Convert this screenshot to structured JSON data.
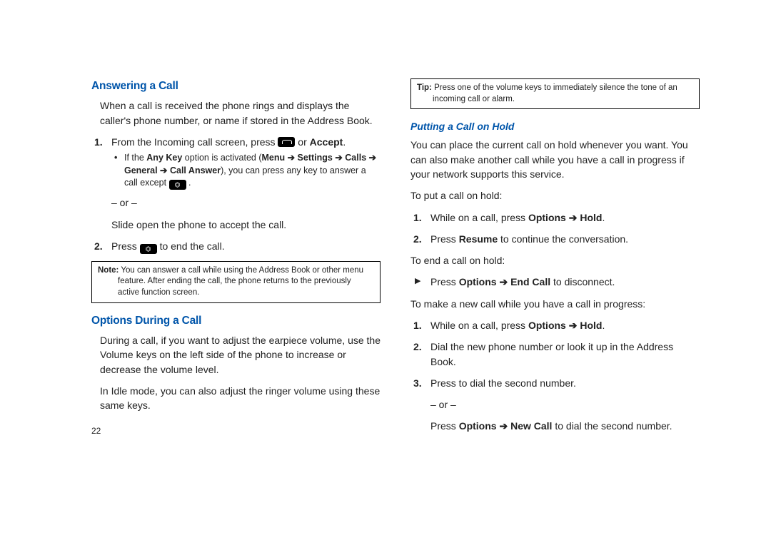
{
  "left": {
    "h_answering": "Answering a Call",
    "p_answer_intro": "When a call is received the phone rings and displays the caller's phone number, or name if stored in the Address Book.",
    "step1_pre": "From the Incoming call screen, press ",
    "step1_post": " or ",
    "accept": "Accept",
    "bullet_anykey_1": "If the ",
    "anykey": "Any Key",
    "bullet_anykey_2": " option is activated (",
    "menu": "Menu",
    "settings": "Settings",
    "calls": "Calls",
    "general": "General",
    "callanswer": "Call Answer",
    "bullet_anykey_3": "), you can press any key to answer a call except ",
    "or": "– or –",
    "slide": "Slide open the phone to accept the call.",
    "step2_pre": "Press ",
    "step2_post": " to end the call.",
    "note_lead": "Note:",
    "note_body": " You can answer a call while using the Address Book or other menu feature. After ending the call, the phone returns to the previously active function screen.",
    "h_options": "Options During a Call",
    "p_volume": "During a call, if you want to adjust the earpiece volume, use the Volume keys on the left side of the phone to increase or decrease the volume level.",
    "p_idle": "In Idle mode, you can also adjust the ringer volume using these same keys.",
    "pagenum": "22"
  },
  "right": {
    "tip_lead": "Tip:",
    "tip_body": " Press one of the volume keys to immediately silence the tone of an incoming call or alarm.",
    "h_hold": "Putting a Call on Hold",
    "p_hold_intro": "You can place the current call on hold whenever you want. You can also make another call while you have a call in progress if your network supports this service.",
    "p_toput": "To put a call on hold:",
    "s1_pre": "While on a call, press ",
    "options": "Options",
    "hold": "Hold",
    "s2_pre": "Press ",
    "resume": "Resume",
    "s2_post": " to continue the conversation.",
    "p_toend": "To end a call on hold:",
    "arrow_pre": "Press ",
    "endcall": "End Call",
    "arrow_post": " to disconnect.",
    "p_newcall": "To make a new call while you have a call in progress:",
    "n2": "Dial the new phone number or look it up in the Address Book.",
    "n3": "Press to dial the second number.",
    "or": "– or –",
    "n3b_pre": "Press ",
    "newcall": "New Call",
    "n3b_post": " to dial the second number.",
    "arrow_glyph": " ➔ ",
    "period": "."
  }
}
